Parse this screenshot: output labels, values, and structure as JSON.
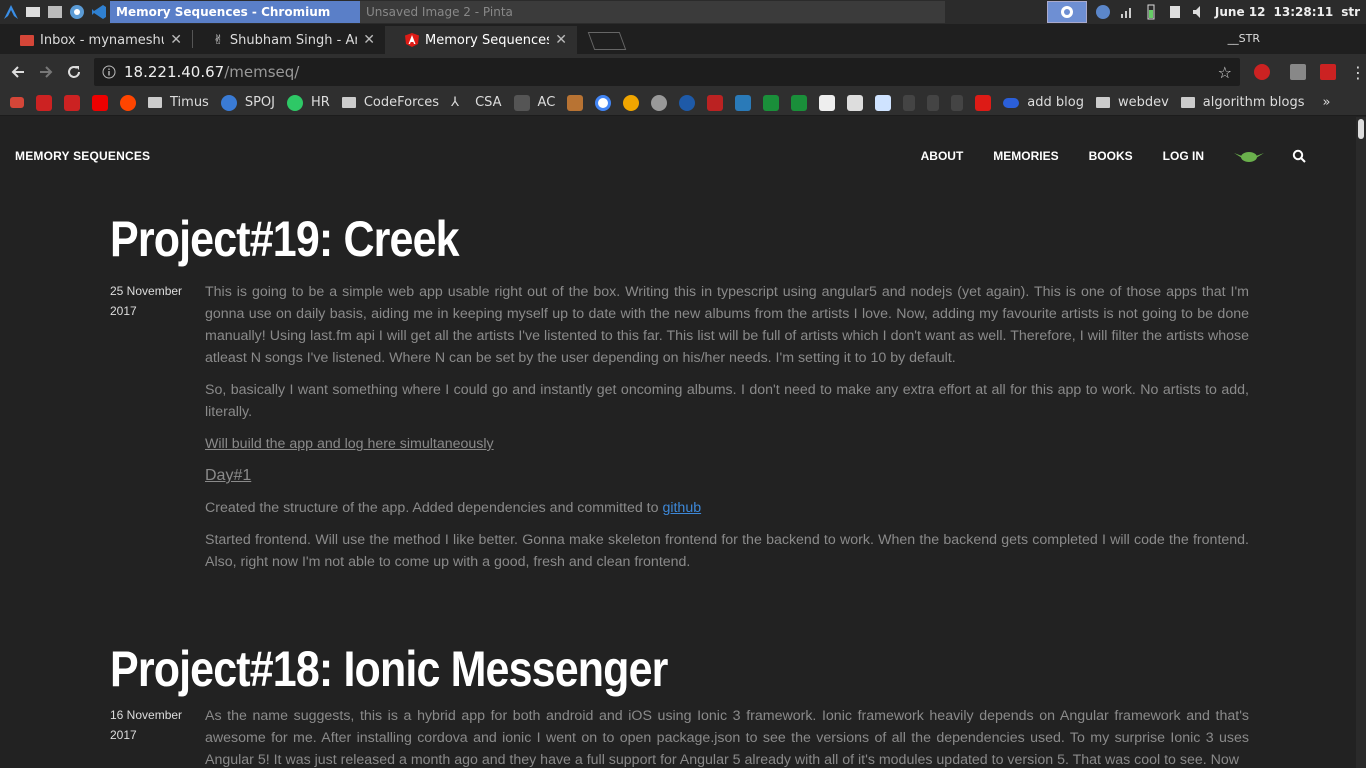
{
  "taskbar": {
    "active_window": "Memory Sequences - Chromium",
    "inactive_window": "Unsaved Image 2 - Pinta",
    "date": "June 12",
    "time": "13:28:11",
    "user": "str"
  },
  "tabs": [
    {
      "title": "Inbox - mynameshubha",
      "icon": "gmail-icon",
      "active": false
    },
    {
      "title": "Shubham Singh - Angel",
      "icon": "angellist-icon",
      "active": false
    },
    {
      "title": "Memory Sequences",
      "icon": "angular-icon",
      "active": true
    }
  ],
  "profile_label": "__STR",
  "address_bar": {
    "host": "18.221.40.67",
    "path": "/memseq/"
  },
  "bookmarks": [
    {
      "label": "",
      "icon": "gmail-icon"
    },
    {
      "label": "",
      "icon": "os-icon"
    },
    {
      "label": "",
      "icon": "os-icon"
    },
    {
      "label": "",
      "icon": "youtube-icon"
    },
    {
      "label": "",
      "icon": "reddit-icon"
    },
    {
      "label": "Timus",
      "icon": "folder-icon"
    },
    {
      "label": "SPOJ",
      "icon": "spoj-icon"
    },
    {
      "label": "HR",
      "icon": "hackerrank-icon"
    },
    {
      "label": "CodeForces",
      "icon": "folder-icon"
    },
    {
      "label": "CSA",
      "icon": "csa-icon"
    },
    {
      "label": "AC",
      "icon": "atcoder-icon"
    },
    {
      "label": "add blog",
      "icon": "cloud-icon"
    },
    {
      "label": "webdev",
      "icon": "folder-icon"
    },
    {
      "label": "algorithm blogs",
      "icon": "folder-icon"
    }
  ],
  "site": {
    "title": "MEMORY SEQUENCES",
    "nav": [
      "ABOUT",
      "MEMORIES",
      "BOOKS",
      "LOG IN"
    ]
  },
  "posts": [
    {
      "title": "Project#19: Creek",
      "date_line1": "25 November",
      "date_line2": "2017",
      "p1": "This is going to be a simple web app usable right out of the box. Writing this in typescript using angular5 and nodejs (yet again). This is one of those apps that I'm gonna use on daily basis, aiding me in keeping myself up to date with the new albums from the artists I love. Now, adding my favourite artists is not going to be done manually! Using last.fm api I will get all the artists I've listented to this far. This list will be full of artists which I don't want as well. Therefore, I will filter the artists whose atleast N songs I've listened. Where N can be set by the user depending on his/her needs. I'm setting it to 10 by default.",
      "p2": "So, basically I want something where I could go and instantly get oncoming albums. I don't need to make any extra effort at all for this app to work. No artists to add, literally.",
      "link1": "Will build the app and log here simultaneously",
      "day": "Day#1",
      "p3_text": "Created the structure of the app. Added dependencies and committed to ",
      "p3_link": "github",
      "p4": "Started frontend. Will use the method I like better. Gonna make skeleton frontend for the backend to work. When the backend gets completed I will code the frontend. Also, right now I'm not able to come up with a good, fresh and clean frontend."
    },
    {
      "title": "Project#18: Ionic Messenger",
      "date_line1": "16 November",
      "date_line2": "2017",
      "p1": "As the name suggests, this is a hybrid app for both android and iOS using Ionic 3 framework. Ionic framework heavily depends on Angular framework and that's awesome for me. After installing cordova and ionic I went on to open package.json to see the versions of all the dependencies used. To my surprise Ionic 3 uses Angular 5! It was just released a month ago and they have a full support for Angular 5 already with all of it's modules updated to version 5. That was cool to see. Now"
    }
  ]
}
